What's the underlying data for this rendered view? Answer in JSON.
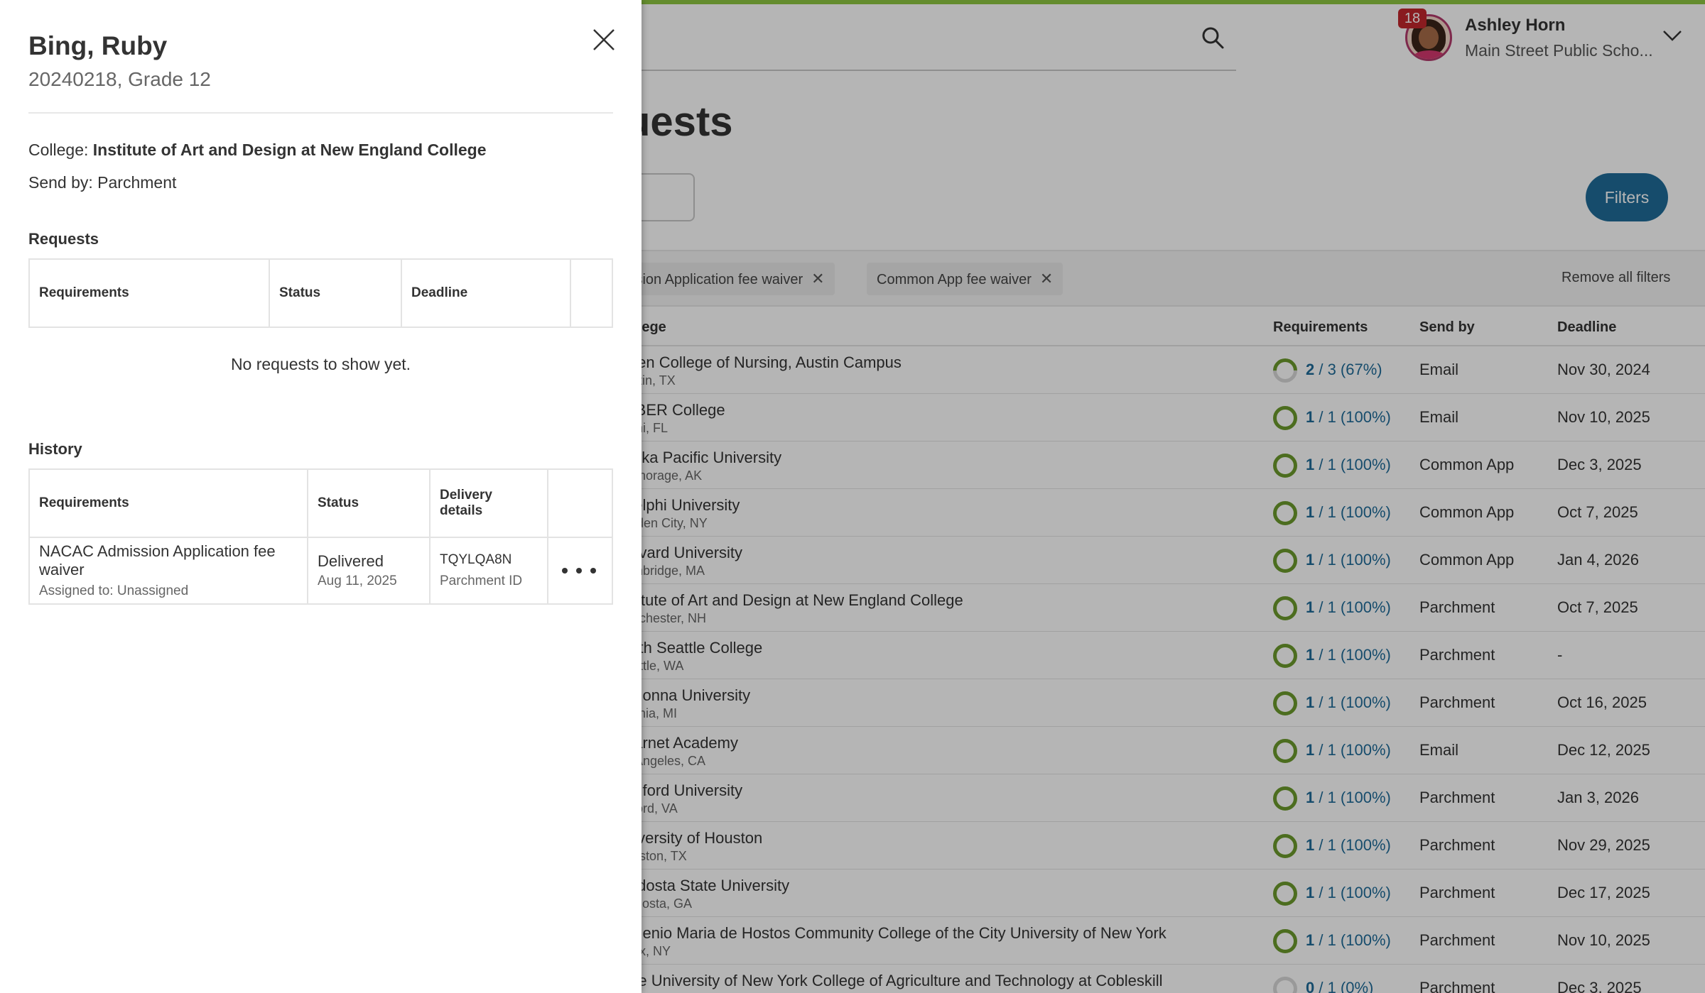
{
  "header": {
    "notification_count": "18",
    "user_name": "Ashley Horn",
    "school": "Main Street Public Scho...",
    "page_title": "uests"
  },
  "toolbar": {
    "filters_label": "Filters"
  },
  "filter_chips": [
    {
      "label": "ission Application fee waiver"
    },
    {
      "label": "Common App fee waiver"
    }
  ],
  "remove_all_filters": "Remove all filters",
  "table": {
    "headers": {
      "college": "ollege",
      "requirements": "Requirements",
      "send_by": "Send by",
      "deadline": "Deadline"
    },
    "rows": [
      {
        "college": "alen College of Nursing, Austin Campus",
        "location": "ustin, TX",
        "req_done": "2",
        "req_rest": " / 3 (67%)",
        "progress": 0.67,
        "send_by": "Email",
        "deadline": "Nov 30, 2024"
      },
      {
        "college": "ABER College",
        "location": "ami, FL",
        "req_done": "1",
        "req_rest": " / 1 (100%)",
        "progress": 1,
        "send_by": "Email",
        "deadline": "Nov 10, 2025"
      },
      {
        "college": "aska Pacific University",
        "location": "nchorage, AK",
        "req_done": "1",
        "req_rest": " / 1 (100%)",
        "progress": 1,
        "send_by": "Common App",
        "deadline": "Dec 3, 2025"
      },
      {
        "college": "delphi University",
        "location": "arden City, NY",
        "req_done": "1",
        "req_rest": " / 1 (100%)",
        "progress": 1,
        "send_by": "Common App",
        "deadline": "Oct 7, 2025"
      },
      {
        "college": "arvard University",
        "location": "ambridge, MA",
        "req_done": "1",
        "req_rest": " / 1 (100%)",
        "progress": 1,
        "send_by": "Common App",
        "deadline": "Jan 4, 2026"
      },
      {
        "college": "stitute of Art and Design at New England College",
        "location": "anchester, NH",
        "req_done": "1",
        "req_rest": " / 1 (100%)",
        "progress": 1,
        "send_by": "Parchment",
        "deadline": "Oct 7, 2025"
      },
      {
        "college": "orth Seattle College",
        "location": "eattle, WA",
        "req_done": "1",
        "req_rest": " / 1 (100%)",
        "progress": 1,
        "send_by": "Parchment",
        "deadline": "-"
      },
      {
        "college": "adonna University",
        "location": "vonia, MI",
        "req_done": "1",
        "req_rest": " / 1 (100%)",
        "progress": 1,
        "send_by": "Parchment",
        "deadline": "Oct 16, 2025"
      },
      {
        "college": "earnet Academy",
        "location": "s Angeles, CA",
        "req_done": "1",
        "req_rest": " / 1 (100%)",
        "progress": 1,
        "send_by": "Email",
        "deadline": "Dec 12, 2025"
      },
      {
        "college": "adford University",
        "location": "dford, VA",
        "req_done": "1",
        "req_rest": " / 1 (100%)",
        "progress": 1,
        "send_by": "Parchment",
        "deadline": "Jan 3, 2026"
      },
      {
        "college": "niversity of Houston",
        "location": "ouston, TX",
        "req_done": "1",
        "req_rest": " / 1 (100%)",
        "progress": 1,
        "send_by": "Parchment",
        "deadline": "Nov 29, 2025"
      },
      {
        "college": "aldosta State University",
        "location": "aldosta, GA",
        "req_done": "1",
        "req_rest": " / 1 (100%)",
        "progress": 1,
        "send_by": "Parchment",
        "deadline": "Dec 17, 2025"
      },
      {
        "college": "ugenio Maria de Hostos Community College of the City University of New York",
        "location": "onx, NY",
        "req_done": "1",
        "req_rest": " / 1 (100%)",
        "progress": 1,
        "send_by": "Parchment",
        "deadline": "Nov 10, 2025"
      },
      {
        "college": "ate University of New York College of Agriculture and Technology at Cobleskill",
        "location": "",
        "req_done": "0",
        "req_rest": " / 1 (0%)",
        "progress": 0,
        "send_by": "Parchment",
        "deadline": "Dec 3, 2025"
      }
    ]
  },
  "drawer": {
    "student_name": "Bing, Ruby",
    "student_sub": "20240218, Grade 12",
    "college_label": "College: ",
    "college_value": "Institute of Art and Design at New England College",
    "send_by": "Send by: Parchment",
    "requests_title": "Requests",
    "requests_headers": {
      "requirements": "Requirements",
      "status": "Status",
      "deadline": "Deadline"
    },
    "requests_empty": "No requests to show yet.",
    "history_title": "History",
    "history_headers": {
      "requirements": "Requirements",
      "status": "Status",
      "delivery": "Delivery details"
    },
    "history_rows": [
      {
        "requirement": "NACAC Admission Application fee waiver",
        "assigned": "Assigned to: Unassigned",
        "status": "Delivered",
        "date": "Aug 11, 2025",
        "code": "TQYLQA8N",
        "code_label": "Parchment ID"
      }
    ]
  },
  "colors": {
    "accent_green": "#8ec641",
    "primary_blue": "#1f6b99",
    "badge_red": "#c1272d",
    "progress_green": "#6c9a2c"
  }
}
